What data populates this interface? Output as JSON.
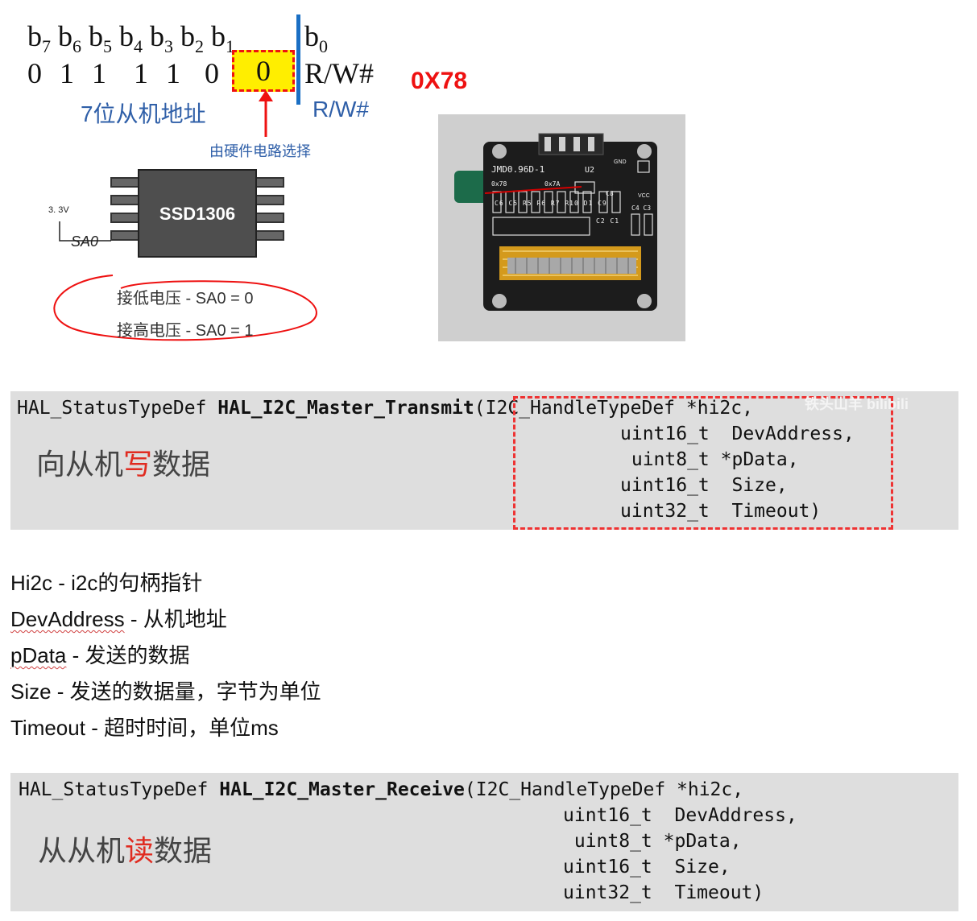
{
  "bit_diagram": {
    "header_bits": [
      {
        "base": "b",
        "sub": "7"
      },
      {
        "base": "b",
        "sub": "6"
      },
      {
        "base": "b",
        "sub": "5"
      },
      {
        "base": "b",
        "sub": "4"
      },
      {
        "base": "b",
        "sub": "3"
      },
      {
        "base": "b",
        "sub": "2"
      },
      {
        "base": "b",
        "sub": "1"
      },
      {
        "base": "b",
        "sub": "0"
      }
    ],
    "values": [
      "0",
      "1",
      "1",
      "1",
      "1",
      "0",
      "0",
      "R/W#"
    ],
    "slave_addr_label": "7位从机地址",
    "rw_label": "R/W#",
    "hw_note": "由硬件电路选择",
    "address_hex": "0X78"
  },
  "chip": {
    "name": "SSD1306",
    "voltage": "3. 3V",
    "pin": "SA0",
    "notes": [
      "接低电压 - SA0 = 0",
      "接高电压 - SA0 = 1"
    ]
  },
  "board_photo": {
    "silk_top": "JMD0.96D-1",
    "u2": "U2",
    "addr_left": "0x78",
    "addr_right": "0x7A",
    "parts": [
      "C6",
      "C5",
      "R5",
      "R6",
      "R7",
      "R10",
      "D1",
      "C9",
      "C2",
      "C1",
      "C8",
      "C4",
      "C3"
    ],
    "pins": [
      "GND",
      "VCC"
    ]
  },
  "transmit_block": {
    "ret_type": "HAL_StatusTypeDef",
    "func_name": "HAL_I2C_Master_Transmit",
    "open_paren": "(",
    "params": [
      "I2C_HandleTypeDef *hi2c,",
      "uint16_t  DevAddress,",
      " uint8_t *pData,",
      "uint16_t  Size,",
      "uint32_t  Timeout)"
    ],
    "cn_prefix": "向从机",
    "cn_highlight": "写",
    "cn_suffix": "数据",
    "watermark": "铁头山羊 bilibili"
  },
  "param_list": [
    {
      "name": "Hi2c",
      "desc": " - i2c的句柄指针",
      "underline": false
    },
    {
      "name": "DevAddress",
      "desc": " - 从机地址",
      "underline": true
    },
    {
      "name": "pData",
      "desc": " - 发送的数据",
      "underline": true
    },
    {
      "name": "Size",
      "desc": " - 发送的数据量，字节为单位",
      "underline": false
    },
    {
      "name": "Timeout",
      "desc": " - 超时时间，单位ms",
      "underline": false
    }
  ],
  "receive_block": {
    "ret_type": "HAL_StatusTypeDef",
    "func_name": "HAL_I2C_Master_Receive",
    "open_paren": "(",
    "params": [
      "I2C_HandleTypeDef *hi2c,",
      "uint16_t  DevAddress,",
      " uint8_t *pData,",
      "uint16_t  Size,",
      "uint32_t  Timeout)"
    ],
    "cn_prefix": "从从机",
    "cn_highlight": "读",
    "cn_suffix": "数据"
  },
  "colors": {
    "red": "#e02b20",
    "blue": "#2f5fa8",
    "code_bg": "#dedede",
    "highlight_yellow": "#ffee00"
  }
}
